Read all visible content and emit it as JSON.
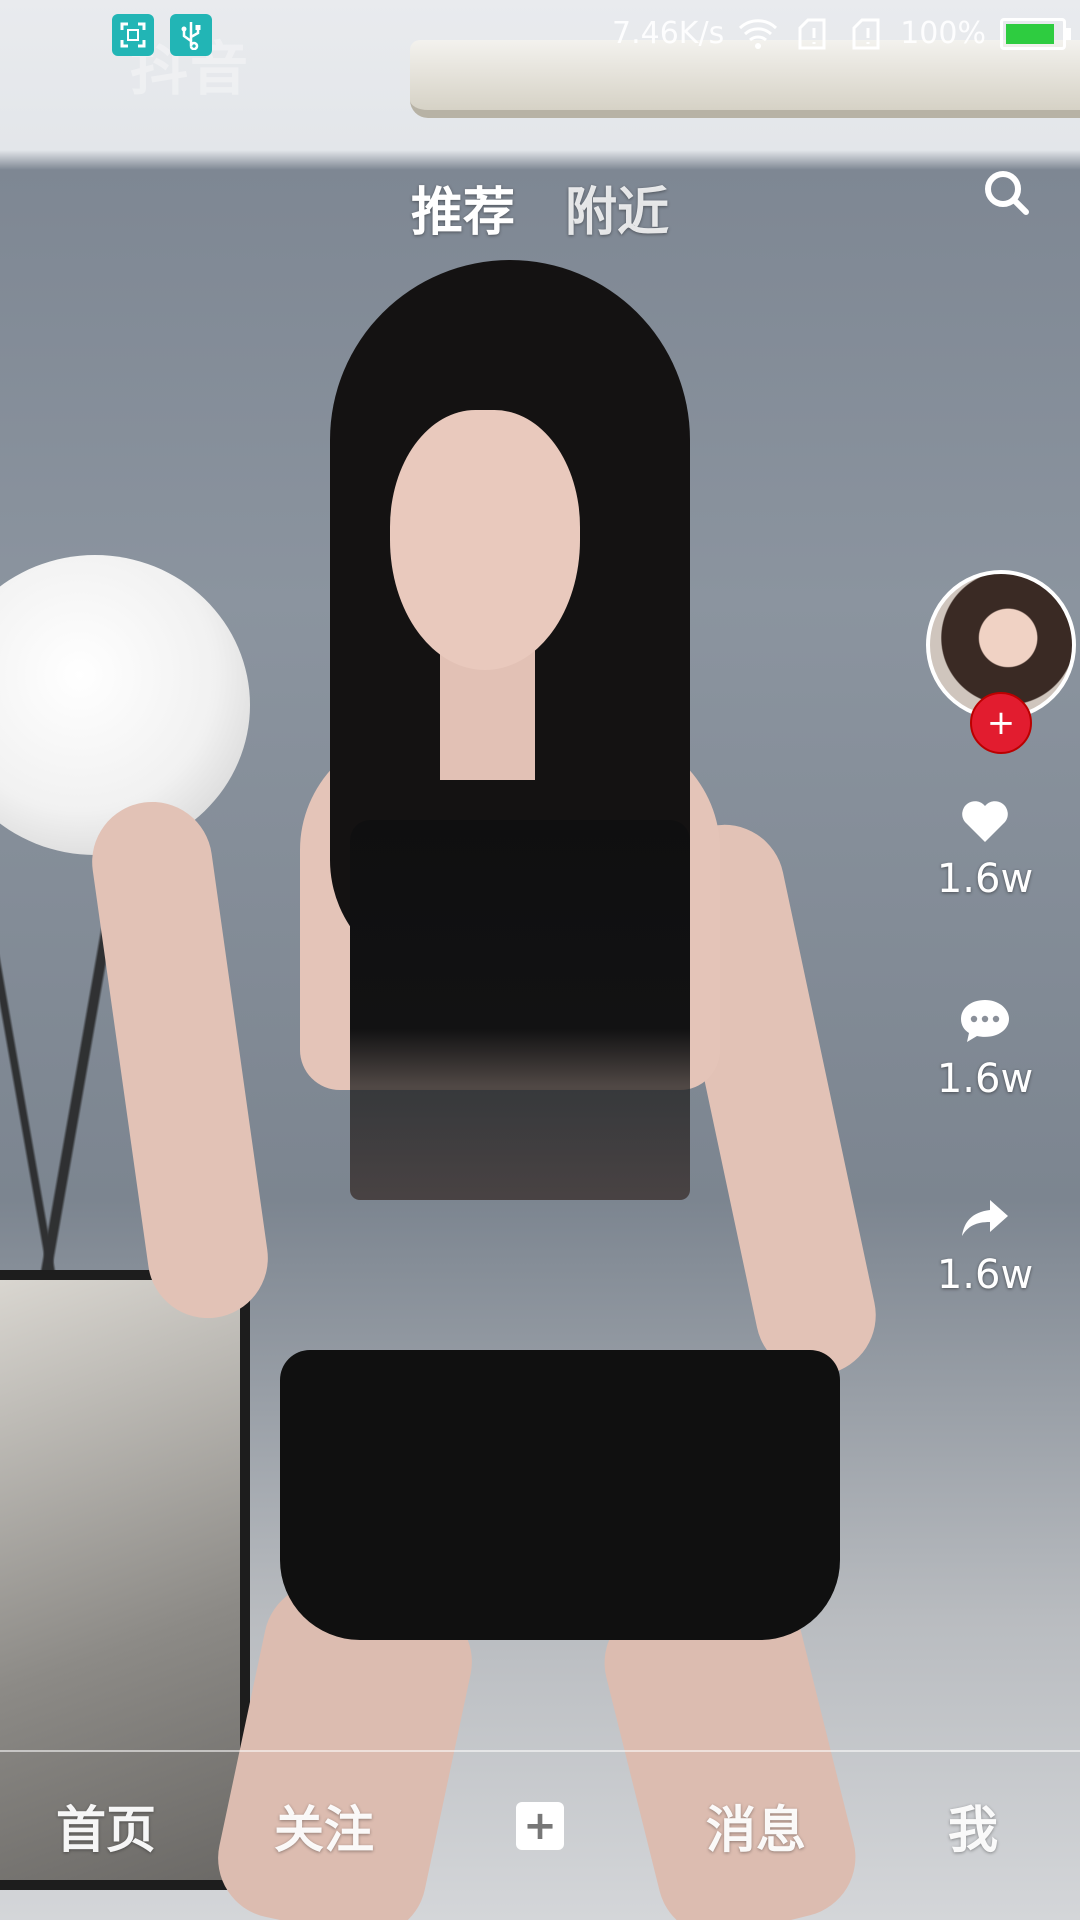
{
  "status_bar": {
    "network_speed": "7.46K/s",
    "battery_percent": "100%",
    "battery_level": 0.8,
    "left_icons": [
      "screenshot-icon",
      "usb-icon"
    ],
    "wifi_icon": "wifi-icon",
    "signal_icons": [
      "sim-signal-icon",
      "sim-signal-icon"
    ],
    "accent_color": "#22b5b5"
  },
  "watermark": {
    "text": "抖音"
  },
  "top_tabs": [
    {
      "label": "推荐",
      "active": true
    },
    {
      "label": "附近",
      "active": false
    }
  ],
  "search": {
    "icon": "search-icon"
  },
  "actions": {
    "avatar": {
      "icon": "avatar"
    },
    "follow": {
      "label": "+",
      "color": "#e21c2f"
    },
    "like": {
      "icon": "heart-icon",
      "count": "1.6w"
    },
    "comment": {
      "icon": "comment-icon",
      "count": "1.6w"
    },
    "share": {
      "icon": "share-icon",
      "count": "1.6w"
    }
  },
  "bottom_nav": {
    "home": "首页",
    "follow": "关注",
    "add": "+",
    "messages": "消息",
    "me": "我"
  }
}
